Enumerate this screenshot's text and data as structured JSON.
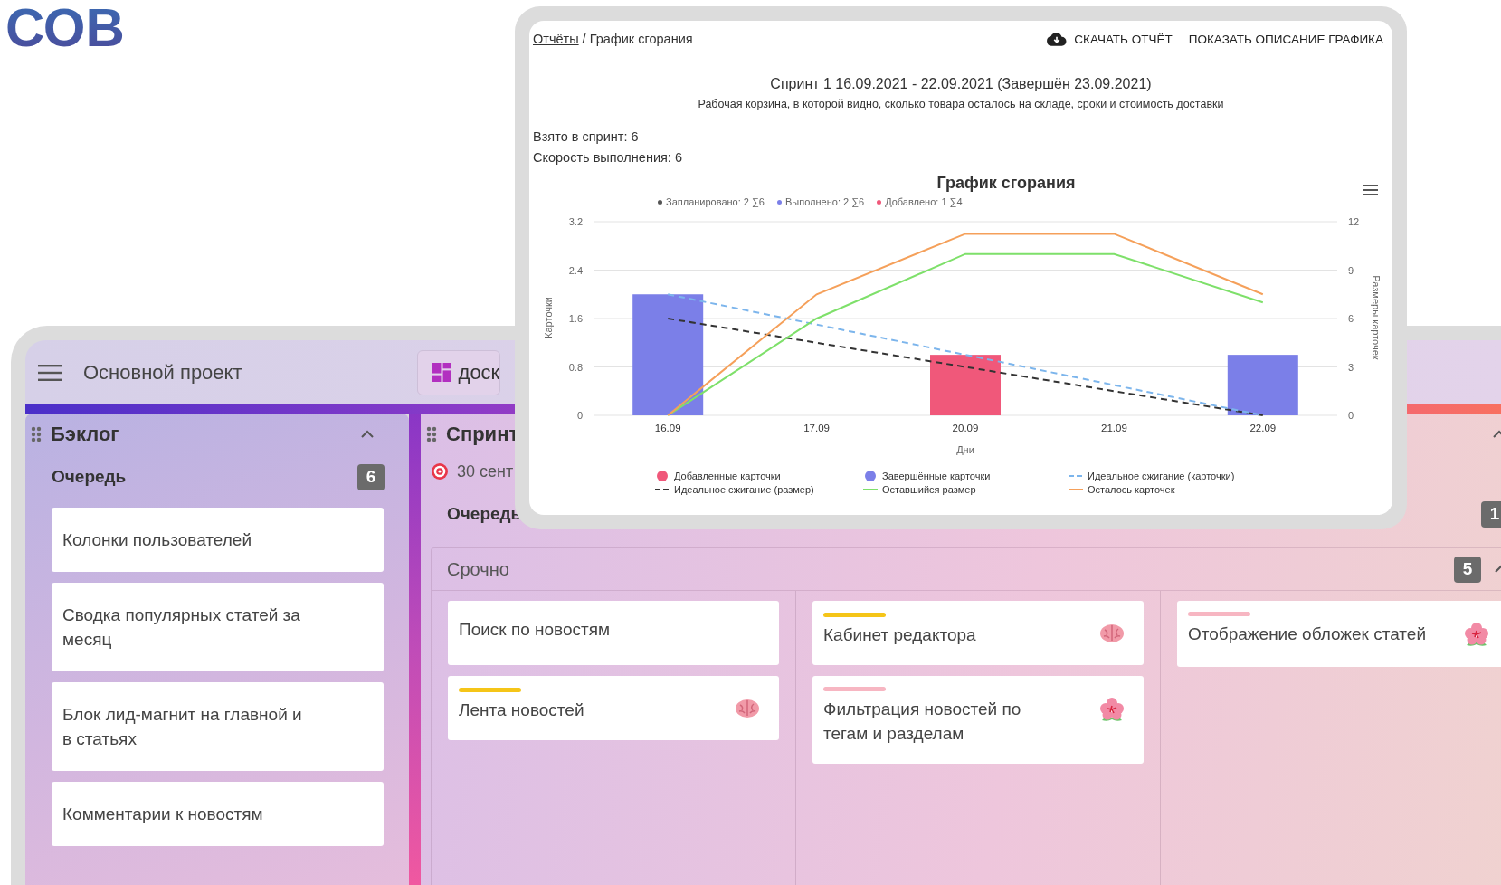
{
  "headline": "СОВ",
  "board": {
    "project": "Основной проект",
    "boards_button": "доск",
    "backlog": {
      "title": "Бэклог",
      "expanded": true,
      "queue": {
        "title": "Очередь",
        "count": "6"
      },
      "cards": [
        {
          "title": "Колонки пользователей"
        },
        {
          "title": "Сводка популярных статей за месяц"
        },
        {
          "title": "Блок лид-магнит на главной и в статьях"
        },
        {
          "title": "Комментарии к новостям"
        }
      ]
    },
    "sprint": {
      "title": "Спринт",
      "date": "30 сент",
      "expanded": true,
      "queue": {
        "title": "Очередь",
        "count": "1"
      },
      "section": {
        "title": "Срочно",
        "count": "5",
        "expanded": true,
        "columns": [
          {
            "cards": [
              {
                "title": "Поиск по новостям",
                "kind": "plain"
              },
              {
                "title": "Лента новостей",
                "kind": "brain",
                "color": "#f5c518"
              }
            ]
          },
          {
            "cards": [
              {
                "title": "Кабинет редактора",
                "kind": "brain",
                "color": "#f5c518"
              },
              {
                "title": "Фильтрация новостей по тегам и разделам",
                "kind": "flower",
                "color": "#f7b6c2"
              }
            ]
          },
          {
            "cards": [
              {
                "title": "Отображение обложек статей",
                "kind": "flower",
                "color": "#f7b6c2"
              }
            ]
          }
        ]
      }
    }
  },
  "report": {
    "breadcrumb_link": "Отчёты",
    "breadcrumb_current": "/ График сгорания",
    "download_button": "СКАЧАТЬ ОТЧЁТ",
    "describe_button": "ПОКАЗАТЬ ОПИСАНИЕ ГРАФИКА",
    "sprint_title": "Спринт 1 16.09.2021 - 22.09.2021 (Завершён 23.09.2021)",
    "description": "Рабочая корзина, в которой видно, сколько товара осталось на складе, сроки и стоимость доставки",
    "stats": [
      "Взято в спринт: 6",
      "Скорость выполнения: 6"
    ],
    "summary": [
      {
        "text": "Запланировано: 2 ∑6",
        "color": "#555555"
      },
      {
        "text": "Выполнено: 2 ∑6",
        "color": "#7b7fe8"
      },
      {
        "text": "Добавлено: 1 ∑4",
        "color": "#f0587a"
      }
    ],
    "chart_data": {
      "type": "bar",
      "title": "График сгорания",
      "xlabel": "Дни",
      "ylabel": "Карточки",
      "y2label": "Размеры карточек",
      "categories": [
        "16.09",
        "17.09",
        "20.09",
        "21.09",
        "22.09"
      ],
      "grid": true,
      "legend": true,
      "yticks": [
        0,
        0.8,
        1.6,
        2.4,
        3.2
      ],
      "y2ticks": [
        0,
        3,
        6,
        9,
        12
      ],
      "ylim": [
        0,
        3.2
      ],
      "y2lim": [
        0,
        12
      ],
      "series": [
        {
          "name": "Добавленные карточки",
          "color": "#f0587a",
          "type": "bar",
          "values": [
            null,
            null,
            1,
            null,
            null
          ]
        },
        {
          "name": "Завершённые карточки",
          "color": "#7b7fe8",
          "type": "bar",
          "values": [
            2,
            null,
            null,
            null,
            1
          ]
        },
        {
          "name": "Идеальное сжигание (карточки)",
          "color": "#7cb5ec",
          "type": "line",
          "line_style": "dashed",
          "values": [
            2,
            1.5,
            1,
            0.5,
            0
          ]
        },
        {
          "name": "Идеальное сжигание (размер)",
          "color": "#333333",
          "type": "line",
          "line_style": "dashed",
          "axis": "y2",
          "values": [
            6,
            4.5,
            3,
            1.5,
            0
          ]
        },
        {
          "name": "Оставшийся размер",
          "color": "#7ee06a",
          "type": "line",
          "axis": "y2",
          "values": [
            0,
            6,
            10,
            10,
            7
          ]
        },
        {
          "name": "Осталось карточек",
          "color": "#f5a05a",
          "type": "line",
          "values": [
            0,
            2,
            3,
            3,
            2
          ]
        }
      ]
    }
  }
}
